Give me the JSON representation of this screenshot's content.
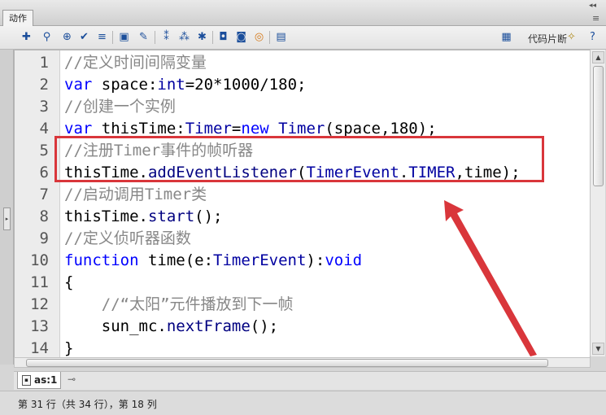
{
  "panel": {
    "tab_label": "动作",
    "collapse_glyph": "◂◂",
    "menu_glyph": "≡"
  },
  "toolbar": {
    "icons": [
      "add-statement-icon",
      "find-icon",
      "target-path-icon",
      "check-syntax-icon",
      "auto-format-icon",
      "code-hint-icon",
      "debug-options-icon",
      "collapse-between-braces-icon",
      "collapse-selection-icon",
      "expand-all-icon",
      "apply-block-comment-icon",
      "apply-line-comment-icon",
      "remove-comment-icon",
      "show-hide-toolbox-icon"
    ],
    "snippets_label": "代码片断",
    "snippets_icon": "magic-wand-icon",
    "help_icon": "help-icon"
  },
  "code": {
    "lines": [
      {
        "n": "1",
        "tokens": [
          {
            "t": "//定义时间间隔变量",
            "c": "cm"
          }
        ]
      },
      {
        "n": "2",
        "tokens": [
          {
            "t": "var",
            "c": "kw"
          },
          {
            "t": " space:",
            "c": ""
          },
          {
            "t": "int",
            "c": "ty"
          },
          {
            "t": "=20*1000/180;",
            "c": ""
          }
        ]
      },
      {
        "n": "3",
        "tokens": [
          {
            "t": "//创建一个实例",
            "c": "cm"
          }
        ]
      },
      {
        "n": "4",
        "tokens": [
          {
            "t": "var",
            "c": "kw"
          },
          {
            "t": " thisTime:",
            "c": ""
          },
          {
            "t": "Timer",
            "c": "ty"
          },
          {
            "t": "=",
            "c": ""
          },
          {
            "t": "new",
            "c": "kw"
          },
          {
            "t": " ",
            "c": ""
          },
          {
            "t": "Timer",
            "c": "ty"
          },
          {
            "t": "(space,180);",
            "c": ""
          }
        ]
      },
      {
        "n": "5",
        "tokens": [
          {
            "t": "//注册Timer事件的帧听器",
            "c": "cm"
          }
        ]
      },
      {
        "n": "6",
        "tokens": [
          {
            "t": "thisTime.",
            "c": ""
          },
          {
            "t": "addEventListener",
            "c": "fn"
          },
          {
            "t": "(",
            "c": ""
          },
          {
            "t": "TimerEvent",
            "c": "ty"
          },
          {
            "t": ".",
            "c": ""
          },
          {
            "t": "TIMER",
            "c": "ty"
          },
          {
            "t": ",time);",
            "c": ""
          }
        ]
      },
      {
        "n": "7",
        "tokens": [
          {
            "t": "//启动调用Timer类",
            "c": "cm"
          }
        ]
      },
      {
        "n": "8",
        "tokens": [
          {
            "t": "thisTime.",
            "c": ""
          },
          {
            "t": "start",
            "c": "fn"
          },
          {
            "t": "();",
            "c": ""
          }
        ]
      },
      {
        "n": "9",
        "tokens": [
          {
            "t": "//定义侦听器函数",
            "c": "cm"
          }
        ]
      },
      {
        "n": "10",
        "tokens": [
          {
            "t": "function",
            "c": "kw"
          },
          {
            "t": " time(e:",
            "c": ""
          },
          {
            "t": "TimerEvent",
            "c": "ty"
          },
          {
            "t": "):",
            "c": ""
          },
          {
            "t": "void",
            "c": "kw"
          }
        ]
      },
      {
        "n": "11",
        "tokens": [
          {
            "t": "{",
            "c": ""
          }
        ]
      },
      {
        "n": "12",
        "tokens": [
          {
            "t": "    ",
            "c": ""
          },
          {
            "t": "//“太阳”元件播放到下一帧",
            "c": "cm"
          }
        ]
      },
      {
        "n": "13",
        "tokens": [
          {
            "t": "    sun_mc.",
            "c": ""
          },
          {
            "t": "nextFrame",
            "c": "fn"
          },
          {
            "t": "();",
            "c": ""
          }
        ]
      },
      {
        "n": "14",
        "tokens": [
          {
            "t": "}",
            "c": ""
          }
        ]
      }
    ]
  },
  "script_tab": {
    "label": "as:1",
    "pin_icon": "pin-icon"
  },
  "status": {
    "text": "第 31 行（共 34 行），第 18 列"
  },
  "annotation": {
    "highlight_color": "#d9363b"
  }
}
